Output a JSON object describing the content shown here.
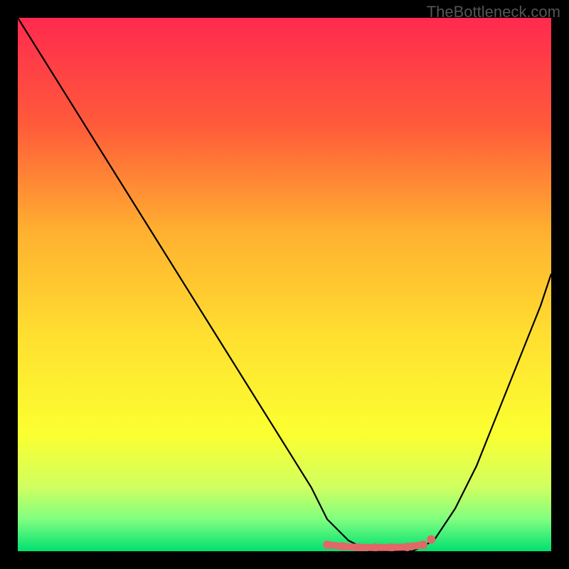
{
  "watermark": "TheBottleneck.com",
  "chart_data": {
    "type": "line",
    "title": "",
    "xlabel": "",
    "ylabel": "",
    "xlim": [
      0,
      100
    ],
    "ylim": [
      0,
      100
    ],
    "gradient_stops": [
      {
        "offset": 0,
        "color": "#ff2a4f"
      },
      {
        "offset": 20,
        "color": "#ff5a3a"
      },
      {
        "offset": 40,
        "color": "#ffb030"
      },
      {
        "offset": 60,
        "color": "#ffe030"
      },
      {
        "offset": 78,
        "color": "#fbff30"
      },
      {
        "offset": 88,
        "color": "#d0ff60"
      },
      {
        "offset": 94,
        "color": "#80ff80"
      },
      {
        "offset": 100,
        "color": "#00e070"
      }
    ],
    "series": [
      {
        "name": "bottleneck-curve",
        "x": [
          0,
          5,
          10,
          15,
          20,
          25,
          30,
          35,
          40,
          45,
          50,
          55,
          58,
          62,
          66,
          70,
          74,
          78,
          82,
          86,
          90,
          94,
          98,
          100
        ],
        "y": [
          100,
          92,
          84,
          76,
          68,
          60,
          52,
          44,
          36,
          28,
          20,
          12,
          6,
          2,
          0,
          0,
          0,
          2,
          8,
          16,
          26,
          36,
          46,
          52
        ]
      }
    ],
    "markers": {
      "name": "optimal-band",
      "color": "#e06868",
      "points": [
        {
          "x": 58,
          "y": 1.2
        },
        {
          "x": 61,
          "y": 0.9
        },
        {
          "x": 64,
          "y": 0.7
        },
        {
          "x": 67,
          "y": 0.7
        },
        {
          "x": 70,
          "y": 0.7
        },
        {
          "x": 73,
          "y": 0.8
        },
        {
          "x": 76,
          "y": 1.2
        }
      ],
      "accent_point": {
        "x": 77.5,
        "y": 2.2
      }
    }
  }
}
